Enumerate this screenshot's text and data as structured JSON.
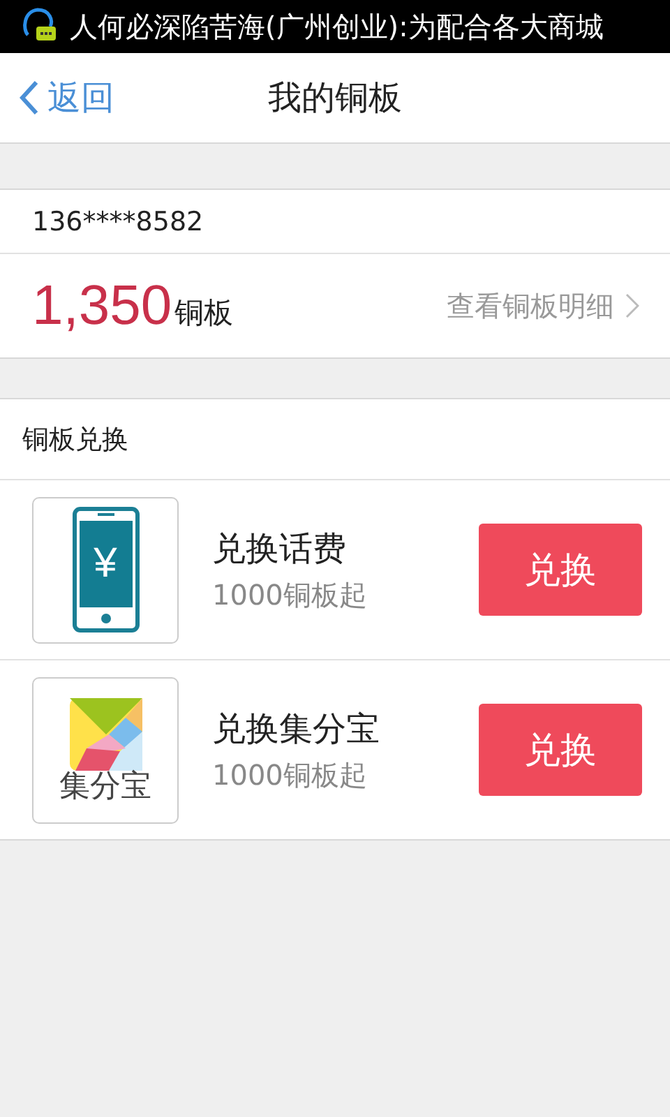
{
  "status_bar": {
    "notification": "人何必深陷苦海(广州创业):为配合各大商城"
  },
  "header": {
    "back": "返回",
    "title": "我的铜板"
  },
  "account": {
    "phone": "136****8582",
    "balance": "1,350",
    "unit": "铜板",
    "details_link": "查看铜板明细"
  },
  "exchange": {
    "title": "铜板兑换",
    "items": [
      {
        "kind": "phone",
        "icon_text": "¥",
        "name": "兑换话费",
        "subtitle": "1000铜板起",
        "button": "兑换"
      },
      {
        "kind": "jifenbao",
        "icon_text": "集分宝",
        "name": "兑换集分宝",
        "subtitle": "1000铜板起",
        "button": "兑换"
      }
    ]
  }
}
